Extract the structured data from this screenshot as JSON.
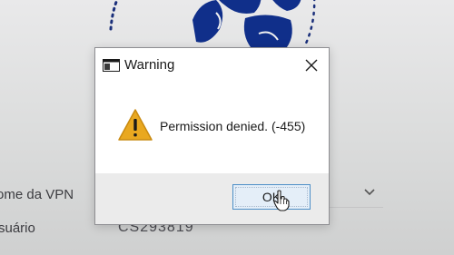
{
  "background": {
    "vpn_name_label": "ome da VPN",
    "user_label": "suário",
    "user_value": "CS293819"
  },
  "dialog": {
    "title": "Warning",
    "message": "Permission denied. (-455)",
    "ok_label": "OK",
    "icons": {
      "app": "window-app-icon",
      "close": "close-icon",
      "warning": "warning-triangle-icon",
      "cursor": "hand-pointer-cursor"
    }
  },
  "colors": {
    "accent": "#4d8fc7",
    "warning": "#e9a820",
    "logo": "#102f8a"
  }
}
